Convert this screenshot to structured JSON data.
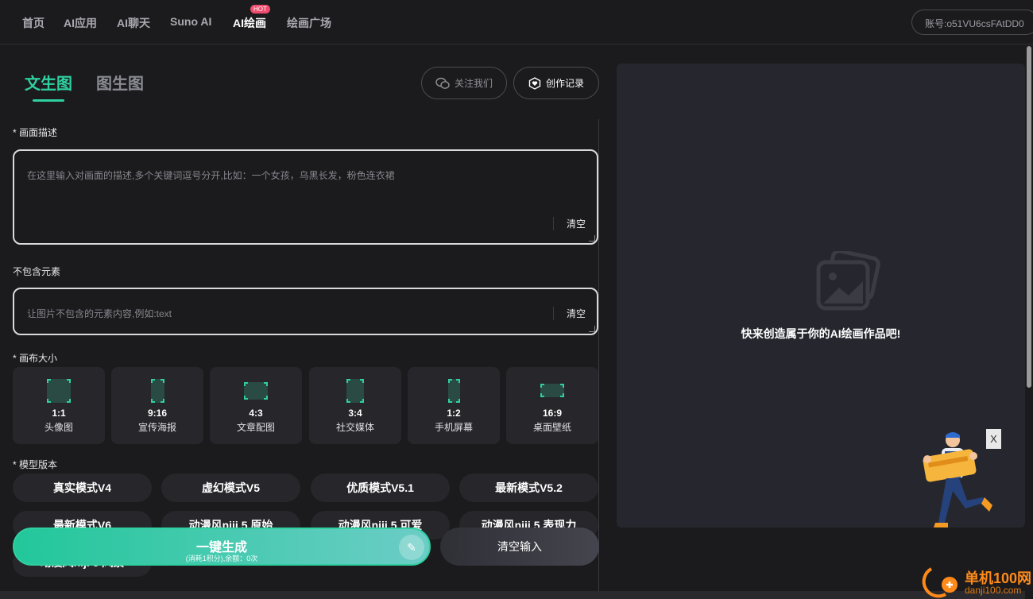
{
  "nav": {
    "items": [
      "首页",
      "AI应用",
      "AI聊天",
      "Suno AI",
      "AI绘画",
      "绘画广场"
    ],
    "hot_badge": "HOT",
    "account": "账号:o51VU6csFAtDD0"
  },
  "tabs": {
    "text_to_image": "文生图",
    "image_to_image": "图生图"
  },
  "buttons": {
    "follow": "关注我们",
    "records": "创作记录"
  },
  "prompt": {
    "label": "* 画面描述",
    "placeholder": "在这里输入对画面的描述,多个关键词逗号分开,比如：一个女孩，乌黑长发，粉色连衣裙",
    "clear": "清空"
  },
  "negative": {
    "label": "不包含元素",
    "placeholder": "让图片不包含的元素内容,例如:text",
    "clear": "清空"
  },
  "canvas": {
    "label": "* 画布大小",
    "ratios": [
      {
        "ratio": "1:1",
        "name": "头像图"
      },
      {
        "ratio": "9:16",
        "name": "宣传海报"
      },
      {
        "ratio": "4:3",
        "name": "文章配图"
      },
      {
        "ratio": "3:4",
        "name": "社交媒体"
      },
      {
        "ratio": "1:2",
        "name": "手机屏幕"
      },
      {
        "ratio": "16:9",
        "name": "桌面壁纸"
      }
    ]
  },
  "model": {
    "label": "* 模型版本",
    "options": [
      "真实模式V4",
      "虚幻模式V5",
      "优质模式V5.1",
      "最新模式V5.2",
      "最新模式V6",
      "动漫风niji 5 原始",
      "动漫风niji 5 可爱",
      "动漫风niji 5 表现力",
      "动漫风niji 5 风景"
    ]
  },
  "generate": {
    "title": "一键生成",
    "subtitle": "(消耗1积分),余额：0次"
  },
  "clear_input": "清空输入",
  "preview": {
    "empty_text": "快来创造属于你的AI绘画作品吧!"
  },
  "popup_close": "X",
  "watermark": {
    "cn": "单机100网",
    "en": "danji100.com"
  },
  "colors": {
    "accent": "#2fd0a0",
    "background": "#1b1b1d",
    "card": "#26262b",
    "hot": "#f04b6e"
  }
}
